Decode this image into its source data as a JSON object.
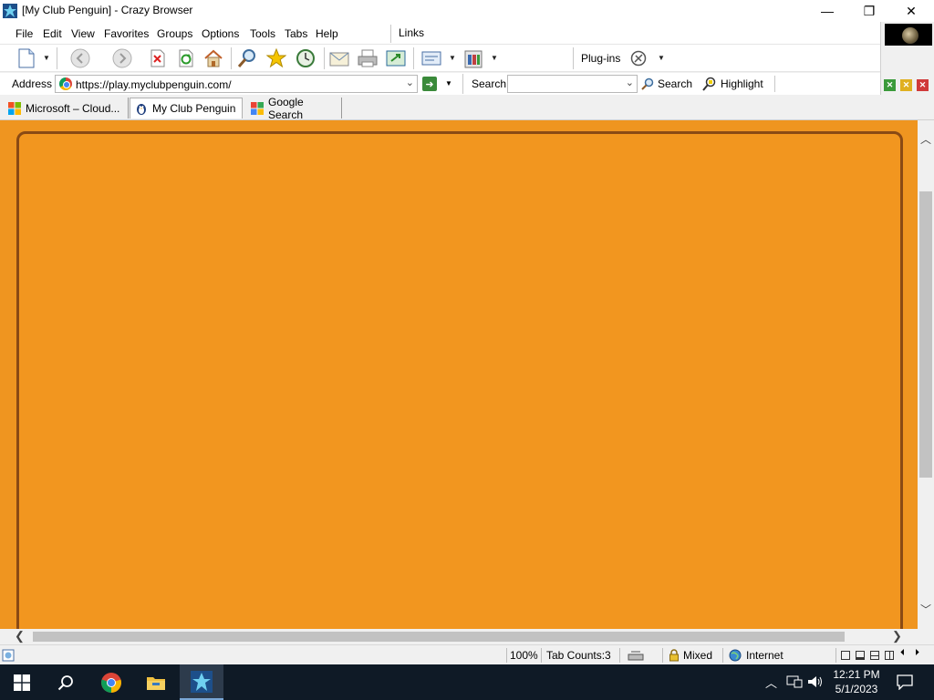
{
  "window": {
    "title": "[My Club Penguin] - Crazy Browser",
    "minimize_glyph": "—",
    "maximize_glyph": "❐",
    "close_glyph": "✕"
  },
  "menu": {
    "items": [
      "File",
      "Edit",
      "View",
      "Favorites",
      "Groups",
      "Options",
      "Tools",
      "Tabs",
      "Help"
    ],
    "links_label": "Links"
  },
  "toolbar": {
    "plugins_label": "Plug-ins",
    "icons": [
      "new-page-icon",
      "back-icon",
      "forward-icon",
      "stop-icon",
      "refresh-icon",
      "home-icon",
      "search-icon",
      "favorites-star-icon",
      "history-icon",
      "mail-icon",
      "print-icon",
      "fullscreen-icon",
      "edit-icon",
      "clipboard-icon",
      "plugins-icon"
    ]
  },
  "address": {
    "label": "Address",
    "url": "https://play.myclubpenguin.com/",
    "search_label": "Search",
    "search_value": "",
    "search_button": "Search",
    "highlight_button": "Highlight"
  },
  "tabs": [
    {
      "label": "Microsoft – Cloud...",
      "active": false
    },
    {
      "label": "My Club Penguin",
      "active": true
    },
    {
      "label": "Google Search",
      "active": false
    }
  ],
  "content": {
    "background_color": "#ef9520",
    "frame_border_color": "#8a4a14"
  },
  "status": {
    "zoom": "100%",
    "tab_counts": "Tab Counts:3",
    "security": "Mixed",
    "zone": "Internet"
  },
  "taskbar": {
    "time": "12:21 PM",
    "date": "5/1/2023",
    "apps": [
      "start-icon",
      "search-icon",
      "chrome-icon",
      "file-explorer-icon",
      "crazy-browser-icon"
    ]
  }
}
